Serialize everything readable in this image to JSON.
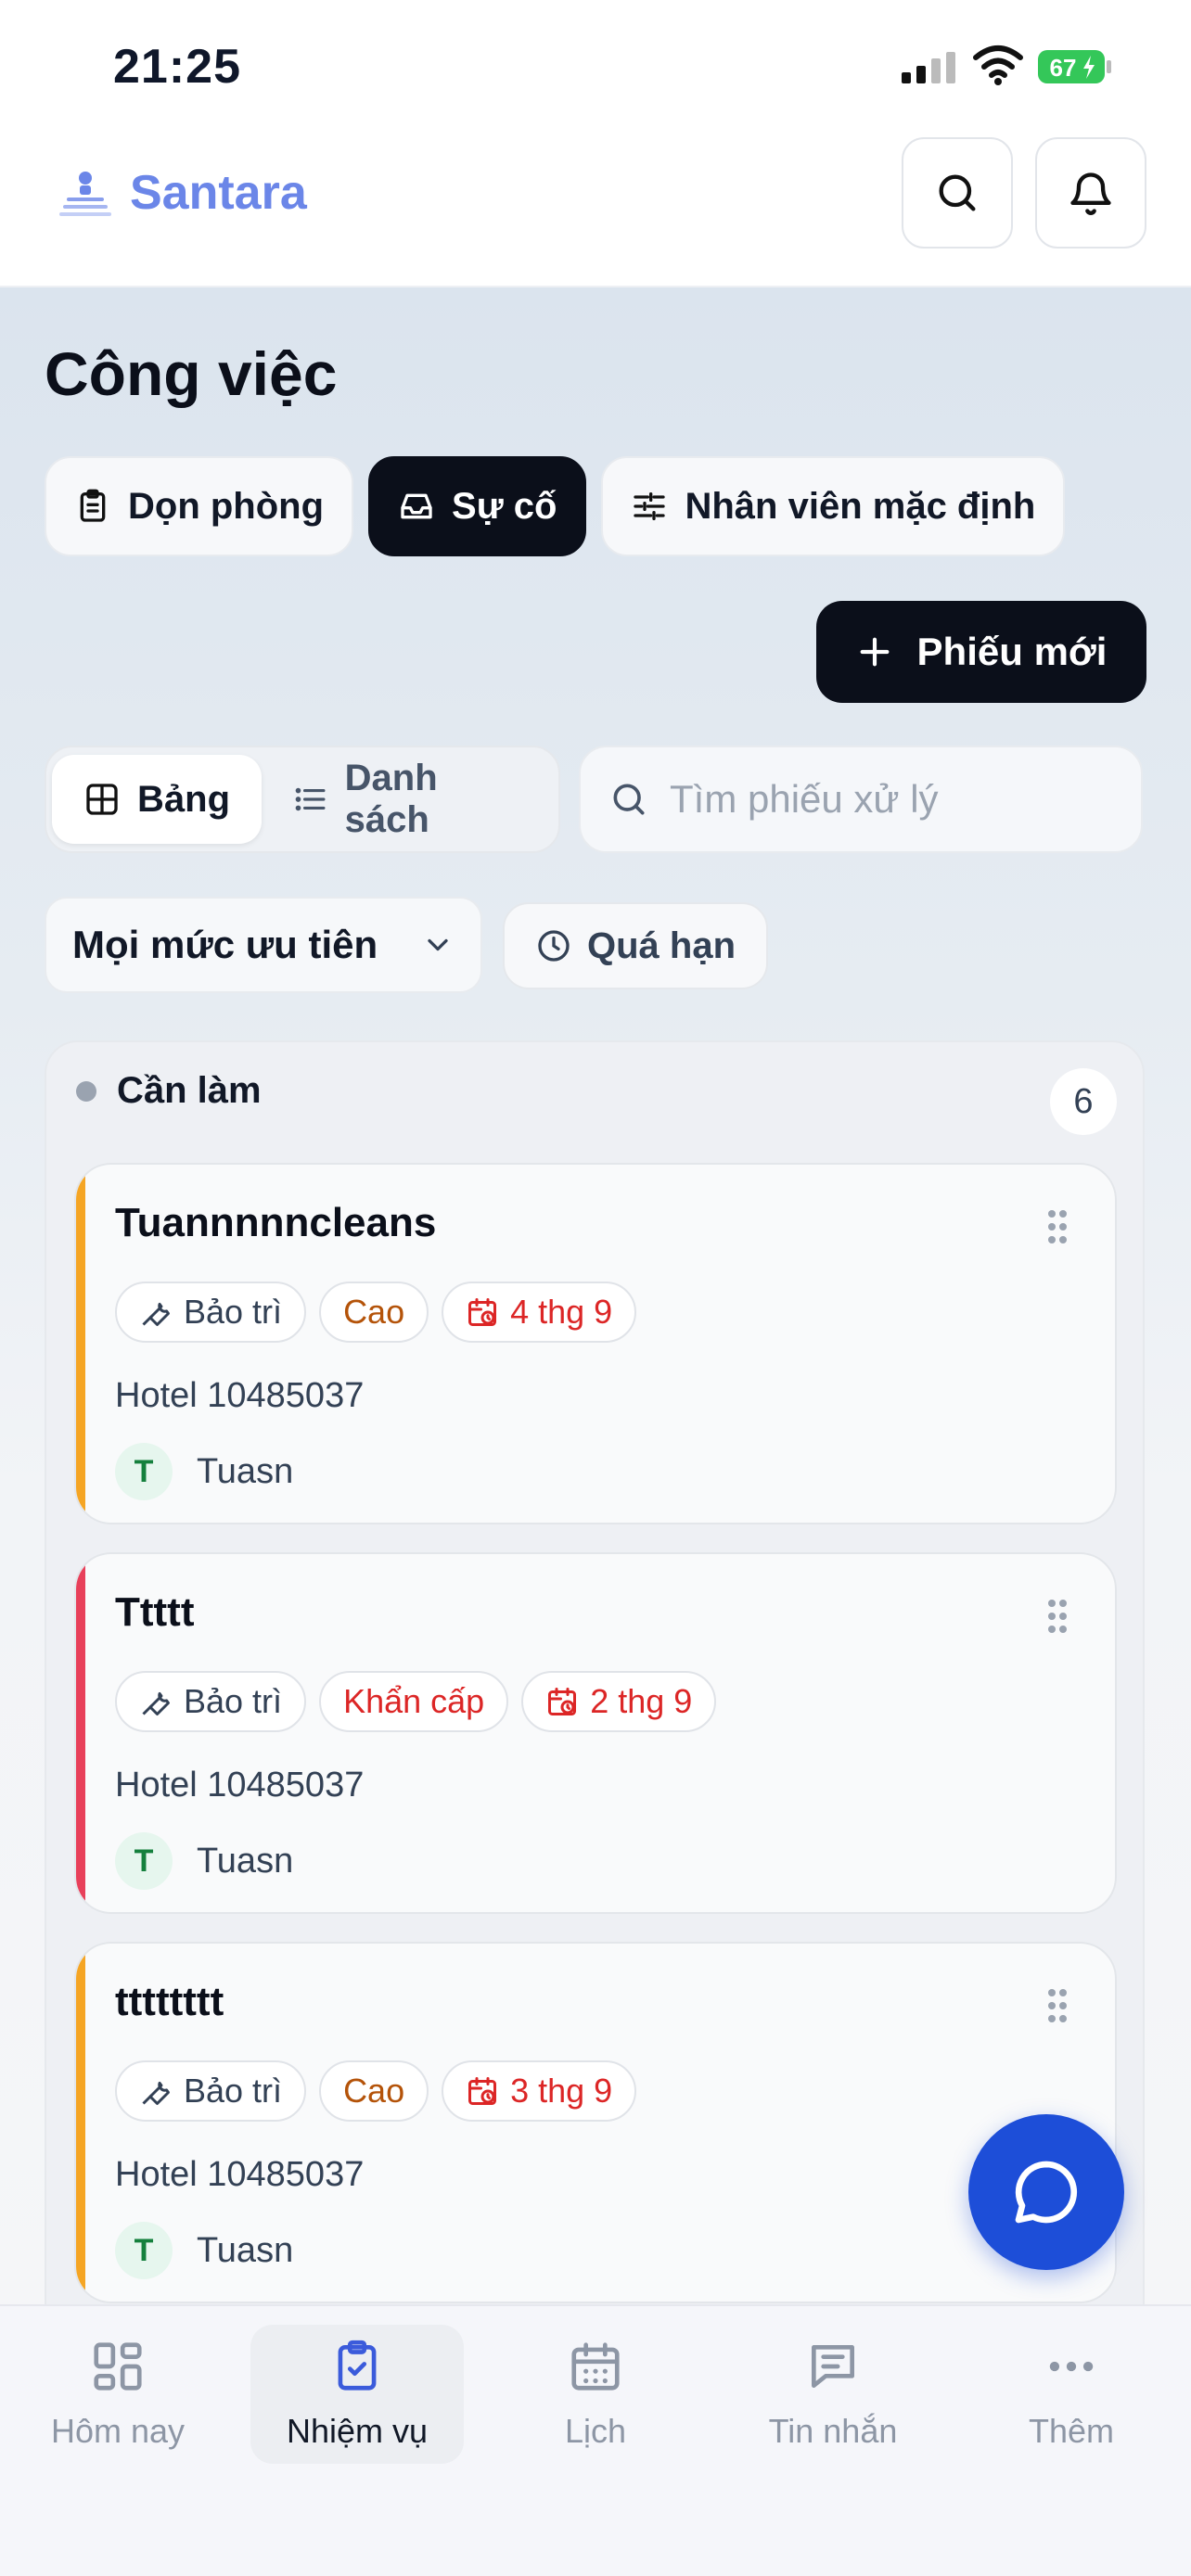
{
  "status_bar": {
    "time": "21:25",
    "battery": "67"
  },
  "header": {
    "brand": "Santara",
    "icons": [
      "search-icon",
      "bell-icon"
    ]
  },
  "page": {
    "title": "Công việc"
  },
  "segments": [
    {
      "label": "Dọn phòng",
      "icon": "clipboard-icon",
      "active": false
    },
    {
      "label": "Sự cố",
      "icon": "inbox-icon",
      "active": true
    },
    {
      "label": "Nhân viên mặc định",
      "icon": "sliders-icon",
      "active": false
    }
  ],
  "new_ticket": {
    "label": "Phiếu mới"
  },
  "view_toggle": {
    "board": "Bảng",
    "list": "Danh sách"
  },
  "search": {
    "placeholder": "Tìm phiếu xử lý"
  },
  "filters": {
    "priority": "Mọi mức ưu tiên",
    "overdue": "Quá hạn"
  },
  "column": {
    "title": "Cần làm",
    "count": "6",
    "cards": [
      {
        "title": "Tuannnnncleans",
        "category": "Bảo trì",
        "priority": "Cao",
        "priority_level": "high",
        "date": "4 thg 9",
        "hotel": "Hotel 10485037",
        "assignee_initial": "T",
        "assignee": "Tuasn",
        "accent": "#f5a524"
      },
      {
        "title": "Ttttt",
        "category": "Bảo trì",
        "priority": "Khẩn cấp",
        "priority_level": "urgent",
        "date": "2 thg 9",
        "hotel": "Hotel 10485037",
        "assignee_initial": "T",
        "assignee": "Tuasn",
        "accent": "#e8405a"
      },
      {
        "title": "tttttttt",
        "category": "Bảo trì",
        "priority": "Cao",
        "priority_level": "high",
        "date": "3 thg 9",
        "hotel": "Hotel 10485037",
        "assignee_initial": "T",
        "assignee": "Tuasn",
        "accent": "#f5a524"
      }
    ]
  },
  "bottom_nav": [
    {
      "label": "Hôm nay",
      "icon": "grid-icon",
      "active": false
    },
    {
      "label": "Nhiệm vụ",
      "icon": "clipboard-check-icon",
      "active": true
    },
    {
      "label": "Lịch",
      "icon": "calendar-icon",
      "active": false
    },
    {
      "label": "Tin nhắn",
      "icon": "message-icon",
      "active": false
    },
    {
      "label": "Thêm",
      "icon": "more-icon",
      "active": false
    }
  ],
  "colors": {
    "brand": "#6b86e8",
    "primary": "#0b0f1a",
    "fab": "#1d4ed8",
    "high": "#b45309",
    "urgent": "#dc2626"
  }
}
